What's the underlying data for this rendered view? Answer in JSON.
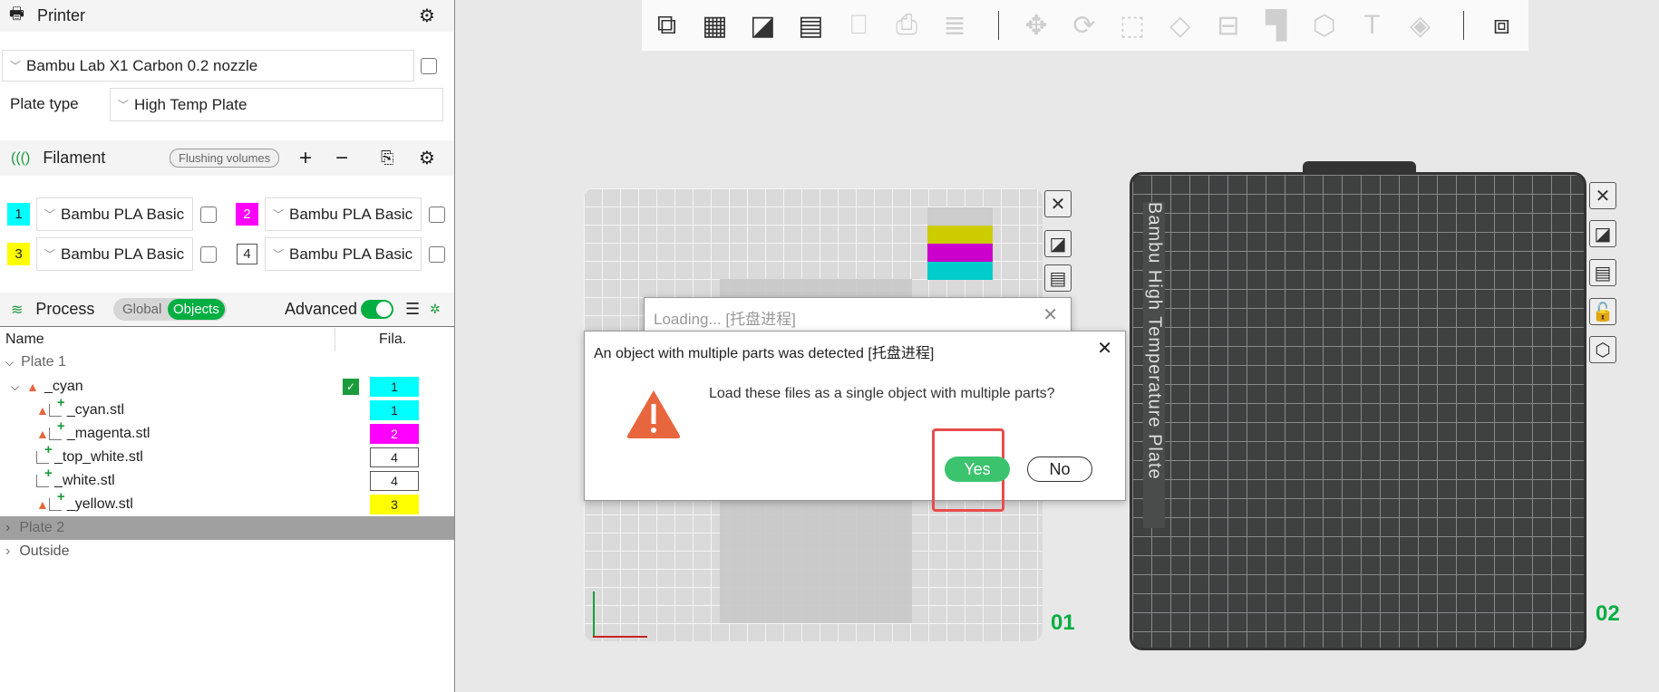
{
  "printer": {
    "title": "Printer",
    "preset": "Bambu Lab X1 Carbon 0.2 nozzle",
    "plate_type_label": "Plate type",
    "plate_type": "High Temp Plate"
  },
  "filament": {
    "title": "Filament",
    "flushing": "Flushing volumes",
    "items": [
      {
        "num": "1",
        "name": "Bambu PLA Basic",
        "color": "#00ffff"
      },
      {
        "num": "2",
        "name": "Bambu PLA Basic",
        "color": "#ff00ff"
      },
      {
        "num": "3",
        "name": "Bambu PLA Basic",
        "color": "#ffff00"
      },
      {
        "num": "4",
        "name": "Bambu PLA Basic",
        "color": "#ffffff"
      }
    ]
  },
  "process": {
    "title": "Process",
    "global": "Global",
    "objects": "Objects",
    "advanced": "Advanced",
    "advanced_on": true
  },
  "table": {
    "col_name": "Name",
    "col_fila": "Fila.",
    "rows": [
      {
        "label": "Plate 1"
      },
      {
        "label": "_cyan",
        "fila": "1",
        "color": "#00ffff",
        "warning": true
      },
      {
        "label": "_cyan.stl",
        "fila": "1",
        "color": "#00ffff",
        "warning": true
      },
      {
        "label": "_magenta.stl",
        "fila": "2",
        "color": "#ff00ff",
        "warning": true
      },
      {
        "label": "_top_white.stl",
        "fila": "4",
        "color": "#ffffff",
        "warning": false
      },
      {
        "label": "_white.stl",
        "fila": "4",
        "color": "#ffffff",
        "warning": false
      },
      {
        "label": "_yellow.stl",
        "fila": "3",
        "color": "#ffff00",
        "warning": true
      },
      {
        "label": "Plate 2"
      },
      {
        "label": "Outside"
      }
    ]
  },
  "plates": {
    "plate1_label": "01",
    "plate2_label": "02",
    "plate2_text": "Bambu High Temperature Plate"
  },
  "loading": {
    "title": "Loading... [托盘进程]"
  },
  "dialog": {
    "title": "An object with multiple parts was detected [托盘进程]",
    "message": "Load these files as a single object with multiple parts?",
    "yes": "Yes",
    "no": "No"
  },
  "colors": {
    "accent": "#00ae42",
    "warning": "#e8663d",
    "highlight": "#e84c4c"
  }
}
